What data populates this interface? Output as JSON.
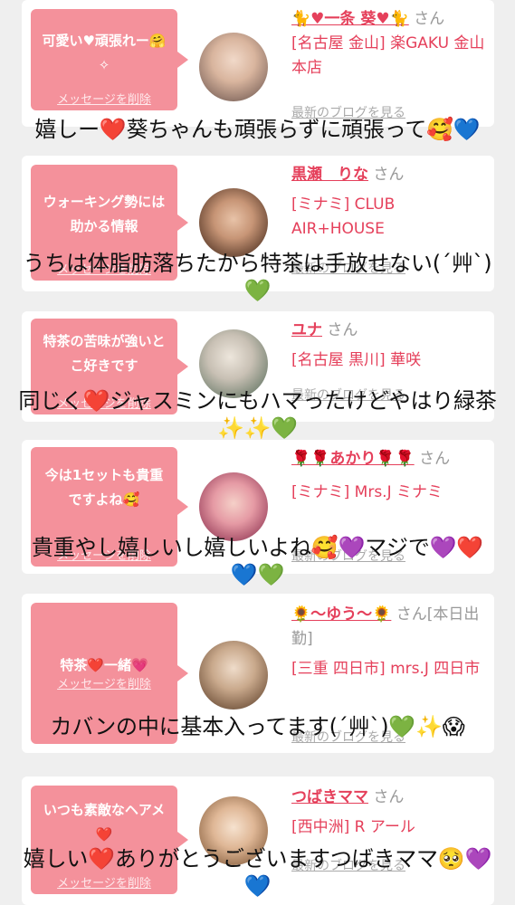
{
  "cards": [
    {
      "message": "可愛い♥頑張れー🤗✧",
      "delete_label": "メッセージを削除",
      "name": "🐈♥一条 葵♥🐈",
      "honorific": "さん",
      "shop": "[名古屋 金山] 楽GAKU 金山本店",
      "blog_link": "最新のブログを見る",
      "overlay": "嬉しー❤️葵ちゃんも頑張らずに頑張って🥰💙"
    },
    {
      "message": "ウォーキング勢には助かる情報",
      "delete_label": "メッセージを削除",
      "name": "黒瀬　りな",
      "honorific": "さん",
      "shop": "[ミナミ] CLUB AIR+HOUSE",
      "blog_link": "最新のブログを見る",
      "overlay": "うちは体脂肪落ちたから特茶は手放せない(´艸`)💚"
    },
    {
      "message": "特茶の苦味が強いとこ好きです",
      "delete_label": "メッセージを削除",
      "name": "ユナ",
      "honorific": "さん",
      "shop": "[名古屋 黒川] 華咲",
      "blog_link": "最新のブログを見る",
      "overlay": "同じく❤️ジャスミンにもハマったけどやはり緑茶✨✨💚"
    },
    {
      "message": "今は1セットも貴重ですよね🥰",
      "delete_label": "メッセージを削除",
      "name": "🌹🌹あかり🌹🌹",
      "honorific": "さん",
      "shop": "[ミナミ] Mrs.J ミナミ",
      "blog_link": "最新のブログを見る",
      "overlay": "貴重やし嬉しいし嬉しいよね🥰💜マジで💜❤️💙💚"
    },
    {
      "message": "特茶❤️一緒💗",
      "delete_label": "メッセージを削除",
      "name": "🌻〜ゆう〜🌻",
      "honorific": "さん[本日出勤]",
      "shop": "[三重 四日市] mrs.J 四日市",
      "blog_link": "最新のブログを見る",
      "overlay": "カバンの中に基本入ってます(´艸`)💚✨😱"
    },
    {
      "message": "いつも素敵なヘアメ❤️",
      "delete_label": "メッセージを削除",
      "name": "つばきママ",
      "honorific": "さん",
      "shop": "[西中洲] R アール",
      "blog_link": "最新のブログを見る",
      "overlay": "嬉しい❤️ありがとうございますつばきママ🥺💜💙"
    }
  ],
  "colors": {
    "bubble": "#f4919b",
    "name": "#e5405b",
    "page_bg": "#efefef"
  }
}
